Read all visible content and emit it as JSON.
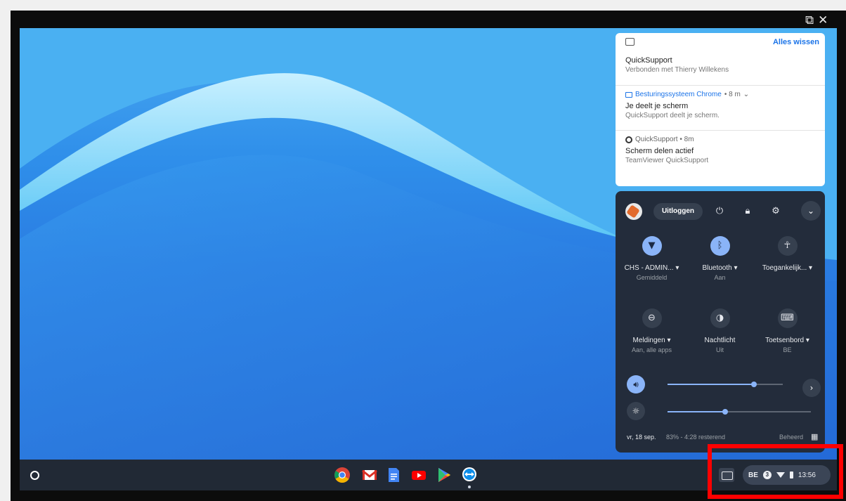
{
  "window": {
    "icons": [
      "open-external-icon",
      "close-icon"
    ]
  },
  "notifications": {
    "clear_all": "Alles wissen",
    "items": [
      {
        "title": "QuickSupport",
        "body": "Verbonden met Thierry Willekens"
      },
      {
        "source": "Besturingssysteem Chrome",
        "time": "• 8 m",
        "title": "Je deelt je scherm",
        "body": "QuickSupport deelt je scherm."
      },
      {
        "source": "QuickSupport • 8m",
        "title": "Scherm delen actief",
        "body": "TeamViewer QuickSupport"
      }
    ]
  },
  "quick_settings": {
    "logout": "Uitloggen",
    "tiles": [
      {
        "label": "CHS - ADMIN...",
        "sub": "Gemiddeld",
        "icon": "wifi-icon",
        "active": true
      },
      {
        "label": "Bluetooth",
        "sub": "Aan",
        "icon": "bluetooth-icon",
        "active": true
      },
      {
        "label": "Toegankelijk...",
        "sub": "",
        "icon": "accessibility-icon",
        "active": false
      },
      {
        "label": "Meldingen",
        "sub": "Aan, alle apps",
        "icon": "notifications-icon",
        "active": false
      },
      {
        "label": "Nachtlicht",
        "sub": "Uit",
        "icon": "night-light-icon",
        "active": false
      },
      {
        "label": "Toetsenbord",
        "sub": "BE",
        "icon": "keyboard-icon",
        "active": false
      }
    ],
    "volume_level": 0.75,
    "brightness_level": 0.4,
    "date": "vr, 18 sep.",
    "battery": "83% - 4:28 resterend",
    "managed": "Beheerd"
  },
  "shelf": {
    "apps": [
      "chrome-icon",
      "gmail-icon",
      "docs-icon",
      "youtube-icon",
      "play-store-icon",
      "teamviewer-icon"
    ],
    "tray": {
      "language": "BE",
      "badge": "3",
      "time": "13:56"
    }
  },
  "colors": {
    "accent": "#8ab4f8",
    "highlight": "#ff0000",
    "panel": "#232c3b"
  }
}
